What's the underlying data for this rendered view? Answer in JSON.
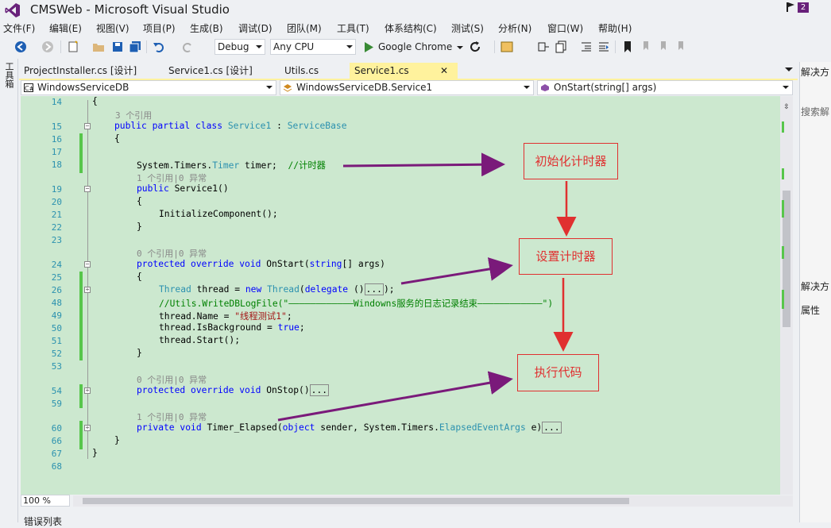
{
  "window": {
    "title": "CMSWeb - Microsoft Visual Studio",
    "notification_count": "2"
  },
  "menu": [
    "文件(F)",
    "编辑(E)",
    "视图(V)",
    "项目(P)",
    "生成(B)",
    "调试(D)",
    "团队(M)",
    "工具(T)",
    "体系结构(C)",
    "测试(S)",
    "分析(N)",
    "窗口(W)",
    "帮助(H)"
  ],
  "toolbar": {
    "config": "Debug",
    "platform": "Any CPU",
    "run_target": "Google Chrome"
  },
  "toolbox_tab": "工具箱",
  "tabs": [
    {
      "label": "ProjectInstaller.cs [设计]",
      "active": false
    },
    {
      "label": "Service1.cs [设计]",
      "active": false
    },
    {
      "label": "Utils.cs",
      "active": false
    },
    {
      "label": "Service1.cs",
      "active": true,
      "close": "✕"
    }
  ],
  "nav": {
    "project": "WindowsServiceDB",
    "class": "WindowsServiceDB.Service1",
    "member": "OnStart(string[] args)"
  },
  "code": {
    "line_numbers": [
      "14",
      "15",
      "16",
      "17",
      "18",
      "19",
      "20",
      "21",
      "22",
      "23",
      "24",
      "25",
      "26",
      "48",
      "49",
      "50",
      "51",
      "52",
      "53",
      "54",
      "59",
      "60",
      "66",
      "67",
      "68"
    ],
    "lens": {
      "service1": "3 个引用",
      "timer": "1 个引用|0 异常",
      "onstart": "0 个引用|0 异常",
      "onstop": "0 个引用|0 异常",
      "elapsed": "1 个引用|0 异常"
    },
    "t": {
      "l14": "{",
      "l15_kw": "public partial class",
      "l15_ty": "Service1",
      "l15_colon": ":",
      "l15_base": "ServiceBase",
      "l16": "{",
      "l18_a": "System.Timers.",
      "l18_ty": "Timer",
      "l18_b": "timer;",
      "l18_cm": "//计时器",
      "l19_kw": "public",
      "l19_b": "Service1()",
      "l20": "{",
      "l21": "InitializeComponent();",
      "l22": "}",
      "l24_kw": "protected override void",
      "l24_b": "OnStart(",
      "l24_kw2": "string",
      "l24_c": "[] args)",
      "l25": "{",
      "l26_ty": "Thread",
      "l26_b": "thread =",
      "l26_kw": "new",
      "l26_ty2": "Thread",
      "l26_c": "(",
      "l26_kw2": "delegate",
      "l26_d": "()",
      "l26_col": "...",
      "l26_e": ");",
      "l48_cm": "//Utils.WriteDBLogFile(\"————————————Windowns服务的日志记录结束————————————\")",
      "l49_a": "thread.Name =",
      "l49_st": "\"线程测试1\"",
      "l49_b": ";",
      "l50_a": "thread.IsBackground =",
      "l50_kw": "true",
      "l50_b": ";",
      "l51": "thread.Start();",
      "l52": "}",
      "l54_kw": "protected override void",
      "l54_b": "OnStop()",
      "l54_col": "...",
      "l60_kw": "private void",
      "l60_b": "Timer_Elapsed(",
      "l60_kw2": "object",
      "l60_c": "sender, System.Timers.",
      "l60_ty": "ElapsedEventArgs",
      "l60_d": "e)",
      "l60_col": "...",
      "l66": "}",
      "l67": "}"
    }
  },
  "annotations": {
    "init_timer": "初始化计时器",
    "set_timer": "设置计时器",
    "run_code": "执行代码",
    "arrow_color": "#7a1a7a",
    "flow_color": "#e03030"
  },
  "status": {
    "zoom": "100 %",
    "error_list": "错误列表"
  },
  "right_panel": {
    "solution": "解决方",
    "search": "搜索解",
    "solution2": "解决方",
    "properties": "属性"
  },
  "colors": {
    "editor_bg": "#cce8cf",
    "active_tab": "#fff29d",
    "accent": "#68217a"
  }
}
